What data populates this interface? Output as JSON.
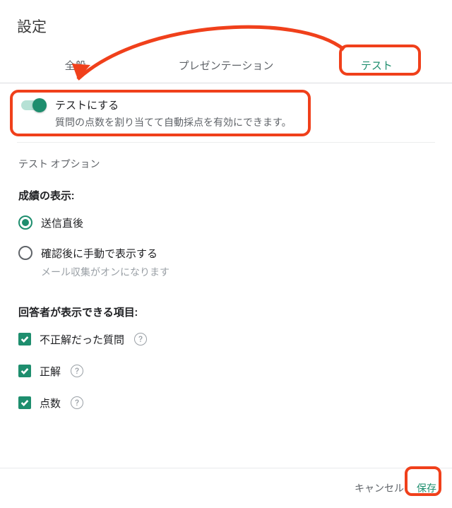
{
  "title": "設定",
  "tabs": {
    "general": "全般",
    "presentation": "プレゼンテーション",
    "test": "テスト"
  },
  "toggle": {
    "label": "テストにする",
    "desc": "質問の点数を割り当てて自動採点を有効にできます。"
  },
  "section_heading": "テスト オプション",
  "grades_label": "成績の表示:",
  "radio": {
    "immediate": "送信直後",
    "manual": "確認後に手動で表示する",
    "manual_sub": "メール収集がオンになります"
  },
  "visible_label": "回答者が表示できる項目:",
  "checks": {
    "incorrect": "不正解だった質問",
    "correct": "正解",
    "points": "点数"
  },
  "footer": {
    "cancel": "キャンセル",
    "save": "保存"
  }
}
